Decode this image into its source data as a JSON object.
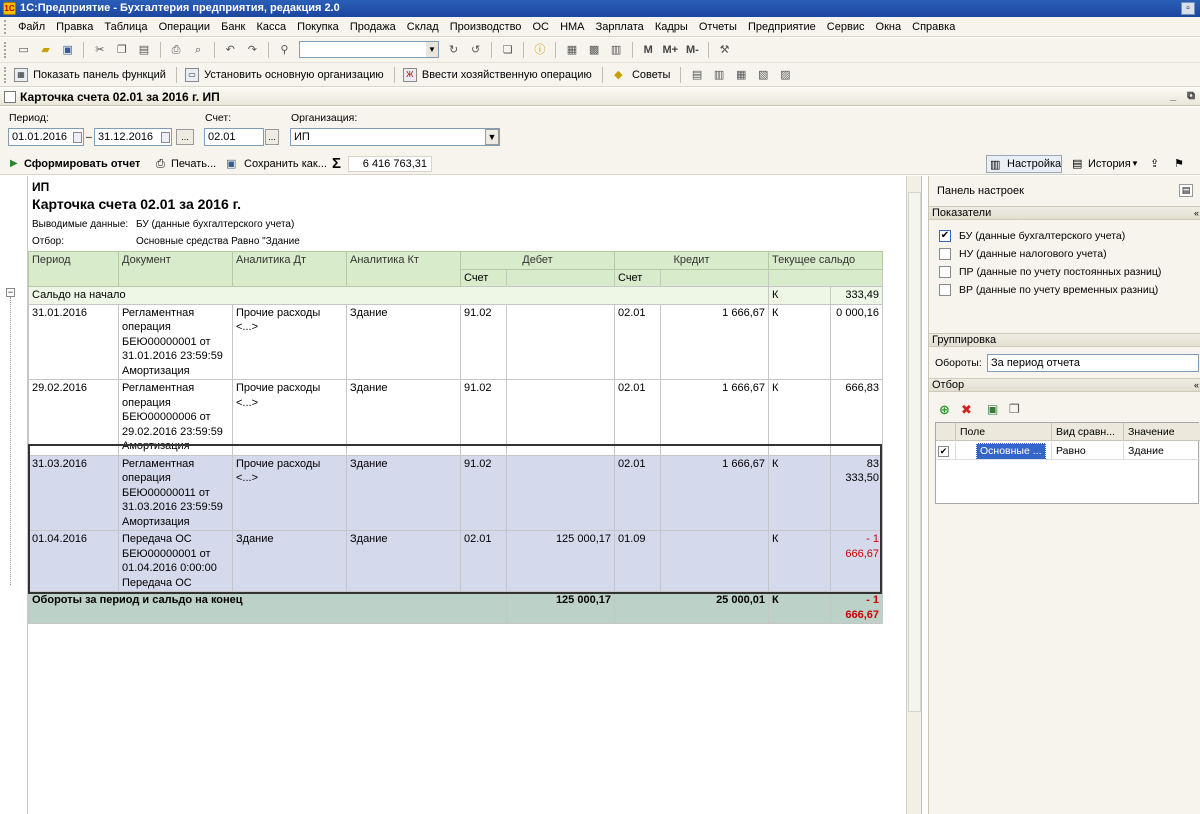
{
  "window": {
    "title": "1С:Предприятие - Бухгалтерия предприятия, редакция 2.0"
  },
  "menu": [
    "Файл",
    "Правка",
    "Таблица",
    "Операции",
    "Банк",
    "Касса",
    "Покупка",
    "Продажа",
    "Склад",
    "Производство",
    "ОС",
    "НМА",
    "Зарплата",
    "Кадры",
    "Отчеты",
    "Предприятие",
    "Сервис",
    "Окна",
    "Справка"
  ],
  "toolbar2": {
    "show_panel": "Показать панель функций",
    "set_org": "Установить основную организацию",
    "enter_op": "Ввести хозяйственную операцию",
    "tips": "Советы"
  },
  "document": {
    "title": "Карточка счета 02.01 за 2016 г. ИП"
  },
  "form": {
    "period_label": "Период:",
    "date_from": "01.01.2016",
    "date_to": "31.12.2016",
    "dots": "...",
    "account_label": "Счет:",
    "account": "02.01",
    "org_label": "Организация:",
    "org": "ИП"
  },
  "commands": {
    "generate": "Сформировать отчет",
    "print": "Печать...",
    "save_as": "Сохранить как...",
    "sigma": "Σ",
    "sum": "6 416 763,31",
    "settings": "Настройка",
    "history": "История"
  },
  "report": {
    "org": "ИП",
    "title": "Карточка счета 02.01 за 2016 г.",
    "output_label": "Выводимые данные:",
    "output_value": "БУ (данные бухгалтерского учета)",
    "filter_label": "Отбор:",
    "filter_value": "Основные средства Равно \"Здание",
    "headers": {
      "period": "Период",
      "document": "Документ",
      "analytics_dt": "Аналитика Дт",
      "analytics_kt": "Аналитика Кт",
      "debit": "Дебет",
      "credit": "Кредит",
      "balance": "Текущее сальдо",
      "account": "Счет"
    },
    "opening": {
      "label": "Сальдо на начало",
      "side": "К",
      "value": "333,49"
    },
    "rows": [
      {
        "period": "31.01.2016",
        "document": "Регламентная операция БЕЮ00000001 от 31.01.2016 23:59:59 Амортизация",
        "adt": "Прочие расходы <...>",
        "akt": "Здание",
        "dt_acc": "91.02",
        "dt_sum": "",
        "kt_acc": "02.01",
        "kt_sum": "1 666,67",
        "side": "К",
        "balance": "0 000,16"
      },
      {
        "period": "29.02.2016",
        "document": "Регламентная операция БЕЮ00000006 от 29.02.2016 23:59:59 Амортизация",
        "adt": "Прочие расходы <...>",
        "akt": "Здание",
        "dt_acc": "91.02",
        "dt_sum": "",
        "kt_acc": "02.01",
        "kt_sum": "1 666,67",
        "side": "К",
        "balance": "666,83"
      },
      {
        "period": "31.03.2016",
        "document": "Регламентная операция БЕЮ00000011 от 31.03.2016 23:59:59 Амортизация",
        "adt": "Прочие расходы <...>",
        "akt": "Здание",
        "dt_acc": "91.02",
        "dt_sum": "",
        "kt_acc": "02.01",
        "kt_sum": "1 666,67",
        "side": "К",
        "balance": "83 333,50"
      },
      {
        "period": "01.04.2016",
        "document": "Передача ОС БЕЮ00000001 от 01.04.2016 0:00:00 Передача ОС",
        "adt": "Здание",
        "akt": "Здание",
        "dt_acc": "02.01",
        "dt_sum": "125 000,17",
        "kt_acc": "01.09",
        "kt_sum": "",
        "side": "К",
        "balance": "- 1 666,67"
      }
    ],
    "totals": {
      "label": "Обороты за период и сальдо на конец",
      "debit": "125 000,17",
      "credit": "25 000,01",
      "side": "К",
      "balance": "- 1 666,67"
    }
  },
  "panel": {
    "title": "Панель настроек",
    "indicators_title": "Показатели",
    "indicators": [
      {
        "label": "БУ (данные бухгалтерского учета)",
        "checked": true
      },
      {
        "label": "НУ (данные налогового учета)",
        "checked": false
      },
      {
        "label": "ПР (данные по учету постоянных разниц)",
        "checked": false
      },
      {
        "label": "ВР (данные по учету временных разниц)",
        "checked": false
      }
    ],
    "grouping_title": "Группировка",
    "turnover_label": "Обороты:",
    "turnover_value": "За период отчета",
    "filter_title": "Отбор",
    "filter_headers": {
      "field": "Поле",
      "comparison": "Вид сравн...",
      "value": "Значение"
    },
    "filter_row": {
      "field": "Основные ...",
      "comparison": "Равно",
      "value": "Здание"
    }
  }
}
